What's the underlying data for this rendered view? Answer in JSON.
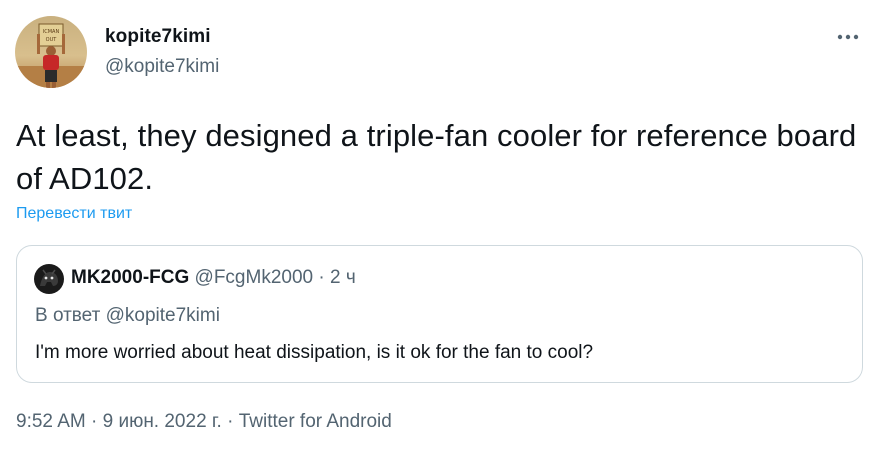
{
  "author": {
    "name": "kopite7kimi",
    "handle": "@kopite7kimi",
    "avatar_sign_text": "ICMAN OUT"
  },
  "tweet": {
    "text": "At least, they designed a triple-fan cooler for reference board of AD102.",
    "translate_label": "Перевести твит"
  },
  "quoted": {
    "name": "MK2000-FCG",
    "handle": "@FcgMk2000",
    "separator": "·",
    "time": "2 ч",
    "reply_to": "В ответ @kopite7kimi",
    "text": "I'm more worried about heat dissipation, is it ok for the fan to cool?"
  },
  "meta": {
    "time": "9:52 AM",
    "date": "9 июн. 2022 г.",
    "separator": "·",
    "source": "Twitter for Android"
  },
  "colors": {
    "text": "#0f1419",
    "secondary": "#536471",
    "link": "#1d9bf0",
    "border": "#cfd9de"
  },
  "icons": {
    "more": "more-dots-icon"
  }
}
